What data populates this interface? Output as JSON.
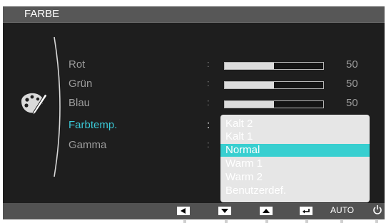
{
  "title": "FARBE",
  "menu_items": [
    {
      "label": "Rot",
      "value": "50",
      "level": 0.5
    },
    {
      "label": "Grün",
      "value": "50",
      "level": 0.5
    },
    {
      "label": "Blau",
      "value": "50",
      "level": 0.5
    },
    {
      "label": "Farbtemp.",
      "active": true
    },
    {
      "label": "Gamma"
    }
  ],
  "colon": ":",
  "dropdown": {
    "options": [
      "Kalt 2",
      "Kalt 1",
      "Normal",
      "Warm 1",
      "Warm 2",
      "Benutzerdef."
    ],
    "selected_index": 2
  },
  "bottom_bar": {
    "buttons": [
      "left-arrow-icon",
      "down-arrow-icon",
      "up-arrow-icon",
      "enter-icon"
    ],
    "auto_label": "AUTO",
    "power_icon": "power-icon"
  },
  "colors": {
    "accent": "#3ac8d6",
    "selected_option": "#38cfd0",
    "background": "#1e1e1e"
  }
}
